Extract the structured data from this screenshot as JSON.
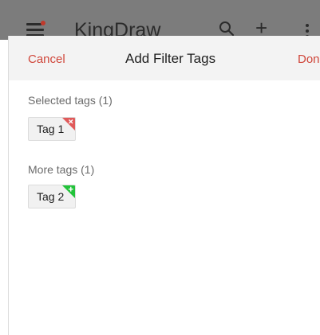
{
  "app_bar": {
    "title": "KingDraw",
    "icons": [
      "menu-icon",
      "search-icon",
      "plus-icon",
      "more-vertical-icon"
    ]
  },
  "sheet": {
    "cancel_label": "Cancel",
    "title": "Add Filter Tags",
    "done_label": "Done"
  },
  "selected_section": {
    "label": "Selected tags (1)",
    "tags": [
      {
        "label": "Tag 1",
        "action_icon": "remove-x-icon",
        "corner_color": "#e05a5a"
      }
    ]
  },
  "more_section": {
    "label": "More tags (1)",
    "tags": [
      {
        "label": "Tag 2",
        "action_icon": "add-plus-icon",
        "corner_color": "#22c33a"
      }
    ]
  },
  "colors": {
    "accent": "#d0463a",
    "header_bg": "#f3f3f3",
    "overlay": "#7c7c7c"
  }
}
